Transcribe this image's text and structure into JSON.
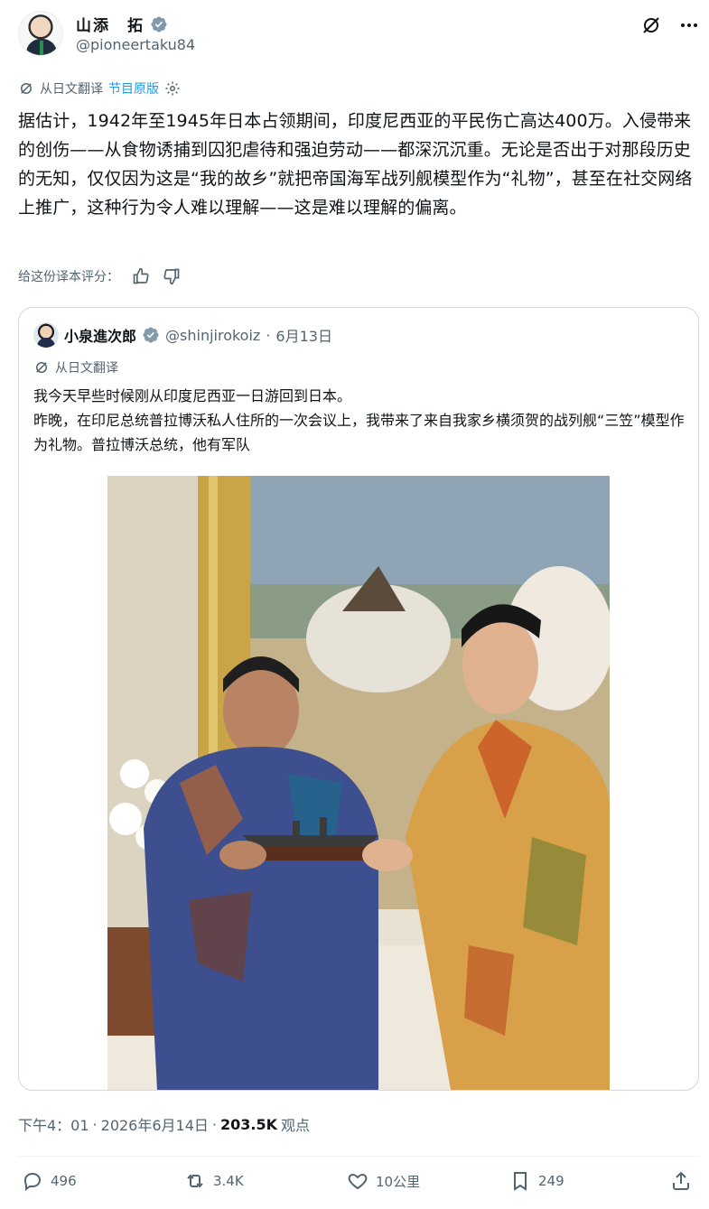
{
  "author": {
    "name": "山添　拓",
    "handle": "@pioneertaku84"
  },
  "translation": {
    "label": "从日文翻译",
    "show_original": "节目原版"
  },
  "post_text": "据估计，1942年至1945年日本占领期间，印度尼西亚的平民伤亡高达400万。入侵带来的创伤——从食物诱捕到囚犯虐待和强迫劳动——都深沉沉重。无论是否出于对那段历史的无知，仅仅因为这是“我的故乡”就把帝国海军战列舰模型作为“礼物”，甚至在社交网络上推广，这种行为令人难以理解——这是难以理解的偏离。",
  "rating": {
    "label": "给这份译本评分："
  },
  "quote": {
    "name": "小泉進次郎",
    "handle": "@shinjirokoiz",
    "separator": "·",
    "date": "6月13日",
    "translation_label": "从日文翻译",
    "line1": "我今天早些时候刚从印度尼西亚一日游回到日本。",
    "line2": "昨晚，在印尼总统普拉博沃私人住所的一次会议上，我带来了来自我家乡横须贺的战列舰“三笠”模型作为礼物。普拉博沃总统，他有军队"
  },
  "meta": {
    "time": "下午4：01",
    "sep": "·",
    "date": "2026年6月14日",
    "sep2": "·",
    "views": "203.5K",
    "views_label": "观点"
  },
  "actions": {
    "replies": "496",
    "reposts": "3.4K",
    "likes": "10公里",
    "bookmarks": "249"
  },
  "colors": {
    "accent": "#1d9bf0",
    "secondary_text": "#536471",
    "verified": "#829aab"
  }
}
